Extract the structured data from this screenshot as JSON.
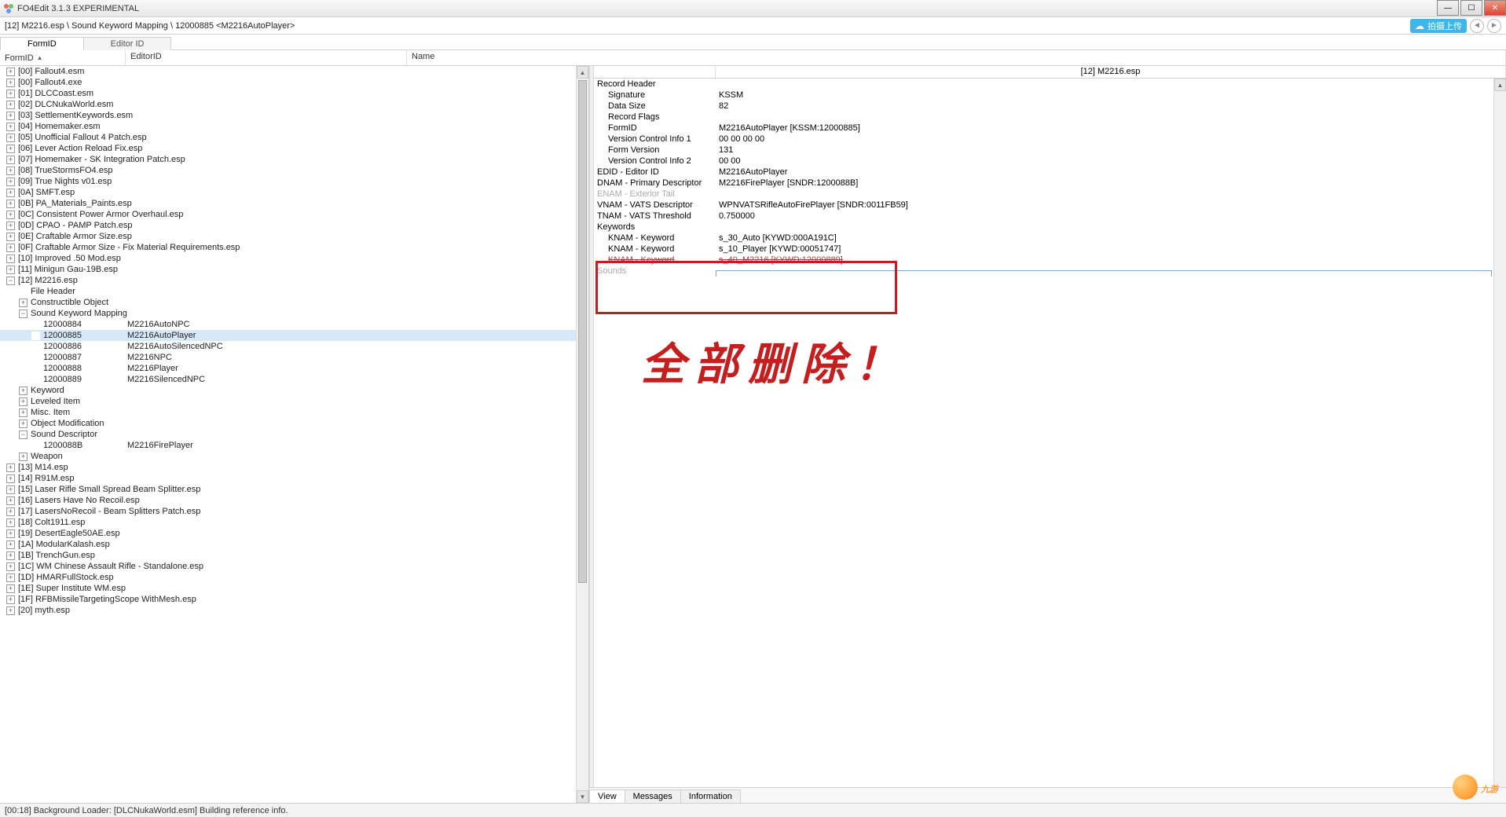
{
  "title": "FO4Edit 3.1.3 EXPERIMENTAL",
  "breadcrumb": "[12] M2216.esp \\ Sound Keyword Mapping \\ 12000885 <M2216AutoPlayer>",
  "upload_label": "拍摄上传",
  "small_tabs": {
    "formid": "FormID",
    "editorid": "Editor ID"
  },
  "tree_headers": {
    "formid": "FormID",
    "editorid": "EditorID",
    "name": "Name"
  },
  "tree": [
    {
      "d": 0,
      "e": "+",
      "f": "[00] Fallout4.esm"
    },
    {
      "d": 0,
      "e": "+",
      "f": "[00] Fallout4.exe"
    },
    {
      "d": 0,
      "e": "+",
      "f": "[01] DLCCoast.esm"
    },
    {
      "d": 0,
      "e": "+",
      "f": "[02] DLCNukaWorld.esm"
    },
    {
      "d": 0,
      "e": "+",
      "f": "[03] SettlementKeywords.esm"
    },
    {
      "d": 0,
      "e": "+",
      "f": "[04] Homemaker.esm"
    },
    {
      "d": 0,
      "e": "+",
      "f": "[05] Unofficial Fallout 4 Patch.esp"
    },
    {
      "d": 0,
      "e": "+",
      "f": "[06] Lever Action Reload Fix.esp"
    },
    {
      "d": 0,
      "e": "+",
      "f": "[07] Homemaker - SK Integration Patch.esp"
    },
    {
      "d": 0,
      "e": "+",
      "f": "[08] TrueStormsFO4.esp"
    },
    {
      "d": 0,
      "e": "+",
      "f": "[09] True Nights v01.esp"
    },
    {
      "d": 0,
      "e": "+",
      "f": "[0A] SMFT.esp"
    },
    {
      "d": 0,
      "e": "+",
      "f": "[0B] PA_Materials_Paints.esp"
    },
    {
      "d": 0,
      "e": "+",
      "f": "[0C] Consistent Power Armor Overhaul.esp"
    },
    {
      "d": 0,
      "e": "+",
      "f": "[0D] CPAO - PAMP Patch.esp"
    },
    {
      "d": 0,
      "e": "+",
      "f": "[0E] Craftable Armor Size.esp"
    },
    {
      "d": 0,
      "e": "+",
      "f": "[0F] Craftable Armor Size - Fix Material Requirements.esp"
    },
    {
      "d": 0,
      "e": "+",
      "f": "[10] Improved .50 Mod.esp"
    },
    {
      "d": 0,
      "e": "+",
      "f": "[11] Minigun Gau-19B.esp"
    },
    {
      "d": 0,
      "e": "-",
      "f": "[12] M2216.esp"
    },
    {
      "d": 1,
      "e": " ",
      "f": "File Header"
    },
    {
      "d": 1,
      "e": "+",
      "f": "Constructible Object"
    },
    {
      "d": 1,
      "e": "-",
      "f": "Sound Keyword Mapping"
    },
    {
      "d": 2,
      "e": " ",
      "f": "12000884",
      "ed": "M2216AutoNPC"
    },
    {
      "d": 2,
      "e": " ",
      "f": "12000885",
      "ed": "M2216AutoPlayer",
      "sel": true
    },
    {
      "d": 2,
      "e": " ",
      "f": "12000886",
      "ed": "M2216AutoSilencedNPC"
    },
    {
      "d": 2,
      "e": " ",
      "f": "12000887",
      "ed": "M2216NPC"
    },
    {
      "d": 2,
      "e": " ",
      "f": "12000888",
      "ed": "M2216Player"
    },
    {
      "d": 2,
      "e": " ",
      "f": "12000889",
      "ed": "M2216SilencedNPC"
    },
    {
      "d": 1,
      "e": "+",
      "f": "Keyword"
    },
    {
      "d": 1,
      "e": "+",
      "f": "Leveled Item"
    },
    {
      "d": 1,
      "e": "+",
      "f": "Misc. Item"
    },
    {
      "d": 1,
      "e": "+",
      "f": "Object Modification"
    },
    {
      "d": 1,
      "e": "-",
      "f": "Sound Descriptor"
    },
    {
      "d": 2,
      "e": " ",
      "f": "1200088B",
      "ed": "M2216FirePlayer"
    },
    {
      "d": 1,
      "e": "+",
      "f": "Weapon"
    },
    {
      "d": 0,
      "e": "+",
      "f": "[13] M14.esp"
    },
    {
      "d": 0,
      "e": "+",
      "f": "[14] R91M.esp"
    },
    {
      "d": 0,
      "e": "+",
      "f": "[15] Laser Rifle Small Spread Beam Splitter.esp"
    },
    {
      "d": 0,
      "e": "+",
      "f": "[16] Lasers Have No Recoil.esp"
    },
    {
      "d": 0,
      "e": "+",
      "f": "[17] LasersNoRecoil - Beam Splitters Patch.esp"
    },
    {
      "d": 0,
      "e": "+",
      "f": "[18] Colt1911.esp"
    },
    {
      "d": 0,
      "e": "+",
      "f": "[19] DesertEagle50AE.esp"
    },
    {
      "d": 0,
      "e": "+",
      "f": "[1A] ModularKalash.esp"
    },
    {
      "d": 0,
      "e": "+",
      "f": "[1B] TrenchGun.esp"
    },
    {
      "d": 0,
      "e": "+",
      "f": "[1C] WM Chinese Assault Rifle - Standalone.esp"
    },
    {
      "d": 0,
      "e": "+",
      "f": "[1D] HMARFullStock.esp"
    },
    {
      "d": 0,
      "e": "+",
      "f": "[1E] Super Institute WM.esp"
    },
    {
      "d": 0,
      "e": "+",
      "f": "[1F] RFBMissileTargetingScope WithMesh.esp"
    },
    {
      "d": 0,
      "e": "+",
      "f": "[20] myth.esp"
    }
  ],
  "right_header_file": "[12] M2216.esp",
  "record": [
    {
      "d": 0,
      "l": "Record Header",
      "v": ""
    },
    {
      "d": 1,
      "l": "Signature",
      "v": "KSSM"
    },
    {
      "d": 1,
      "l": "Data Size",
      "v": "82"
    },
    {
      "d": 1,
      "l": "Record Flags",
      "v": ""
    },
    {
      "d": 1,
      "l": "FormID",
      "v": "M2216AutoPlayer [KSSM:12000885]"
    },
    {
      "d": 1,
      "l": "Version Control Info 1",
      "v": "00 00 00 00"
    },
    {
      "d": 1,
      "l": "Form Version",
      "v": "131"
    },
    {
      "d": 1,
      "l": "Version Control Info 2",
      "v": "00 00"
    },
    {
      "d": 0,
      "l": "EDID - Editor ID",
      "v": "M2216AutoPlayer"
    },
    {
      "d": 0,
      "l": "DNAM - Primary Descriptor",
      "v": "M2216FirePlayer [SNDR:1200088B]"
    },
    {
      "d": 0,
      "l": "ENAM - Exterior Tail",
      "v": "",
      "gray": true
    },
    {
      "d": 0,
      "l": "VNAM - VATS Descriptor",
      "v": "WPNVATSRifleAutoFirePlayer [SNDR:0011FB59]"
    },
    {
      "d": 0,
      "l": "TNAM - VATS Threshold",
      "v": "0.750000"
    },
    {
      "d": 0,
      "l": "Keywords",
      "v": ""
    },
    {
      "d": 1,
      "l": "KNAM - Keyword",
      "v": "s_30_Auto [KYWD:000A191C]"
    },
    {
      "d": 1,
      "l": "KNAM - Keyword",
      "v": "s_10_Player [KYWD:00051747]"
    },
    {
      "d": 1,
      "l": "KNAM - Keyword",
      "v": "s_40_M2216 [KYWD:12000889]",
      "struck": true
    },
    {
      "d": 0,
      "l": "Sounds",
      "v": "",
      "gray": true,
      "input": true
    }
  ],
  "annotation_text": "全部删除！",
  "bottom_tabs": {
    "view": "View",
    "messages": "Messages",
    "information": "Information"
  },
  "status": "[00:18] Background Loader: [DLCNukaWorld.esm] Building reference info.",
  "watermark": "九游"
}
